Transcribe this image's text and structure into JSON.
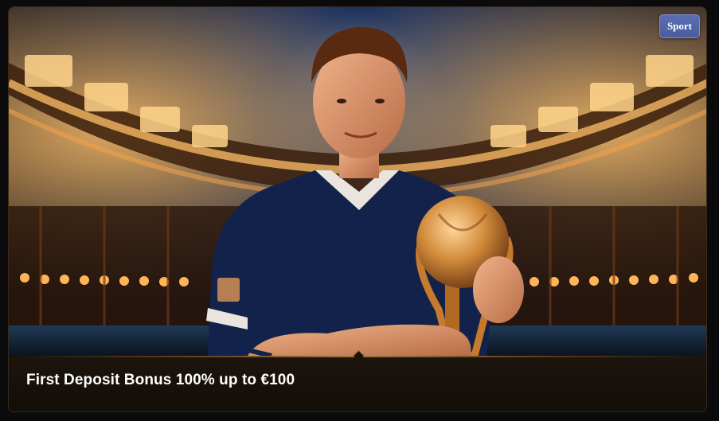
{
  "promo": {
    "title": "First Deposit Bonus 100% up to €100",
    "category_badge": "Sport"
  },
  "image": {
    "subject": "football-player-holding-trophy",
    "colors": {
      "sky": "#0f1f44",
      "stadium_lights": "#f2a54a",
      "jersey": "#13224a",
      "trophy": "#c77a2d",
      "badge": "#4a5c9e"
    }
  }
}
